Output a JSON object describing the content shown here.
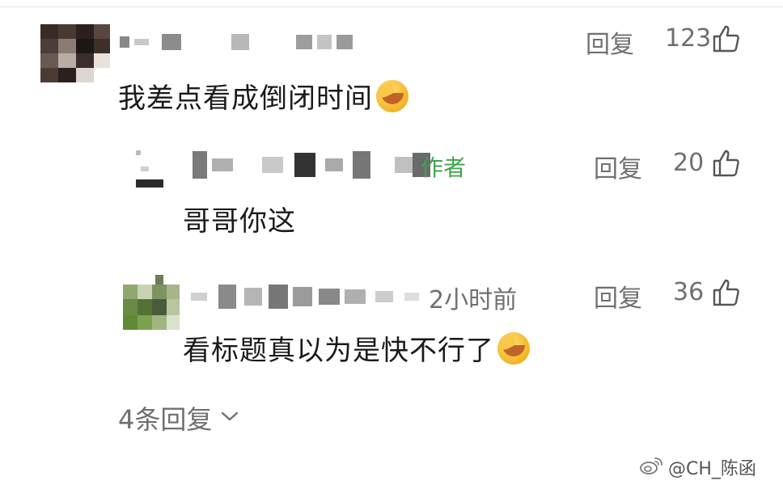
{
  "comments": [
    {
      "text": "我差点看成倒闭时间",
      "reply_label": "回复",
      "likes": "123"
    },
    {
      "author_tag": "作者",
      "text": "哥哥你这",
      "reply_label": "回复",
      "likes": "20"
    },
    {
      "time": "2小时前",
      "text": "看标题真以为是快不行了",
      "reply_label": "回复",
      "likes": "36"
    }
  ],
  "more_replies": {
    "label": "4条回复"
  },
  "watermark": {
    "text": "@CH_陈函"
  },
  "icons": {
    "like": "thumbs-up-icon",
    "emoji": "facepalm-laugh-emoji",
    "expand": "chevron-down-icon",
    "weibo": "weibo-logo-icon"
  },
  "colors": {
    "meta_gray": "#6f6f6f",
    "author_green": "#3fa34d",
    "text": "#1a1a1a"
  }
}
